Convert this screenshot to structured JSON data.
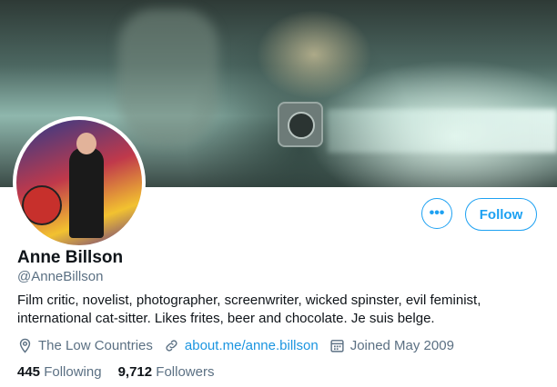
{
  "profile": {
    "name": "Anne Billson",
    "handle": "@AnneBillson",
    "bio_line1": "Film critic, novelist, photographer, screenwriter, wicked spinster, evil feminist,",
    "bio_line2": "international cat-sitter. Likes frites, beer and chocolate. Je suis belge.",
    "location": "The Low Countries",
    "website": "about.me/anne.billson",
    "joined": "Joined May 2009"
  },
  "actions": {
    "more_label": "•••",
    "follow_label": "Follow"
  },
  "stats": {
    "following_count": "445",
    "following_label": "Following",
    "followers_count": "9,712",
    "followers_label": "Followers"
  },
  "icons": {
    "location": "location-pin-icon",
    "link": "link-icon",
    "calendar": "calendar-icon"
  },
  "colors": {
    "accent": "#1da1f2",
    "link": "#1b95e0",
    "secondary_text": "#5b7083",
    "primary_text": "#0f1419"
  }
}
